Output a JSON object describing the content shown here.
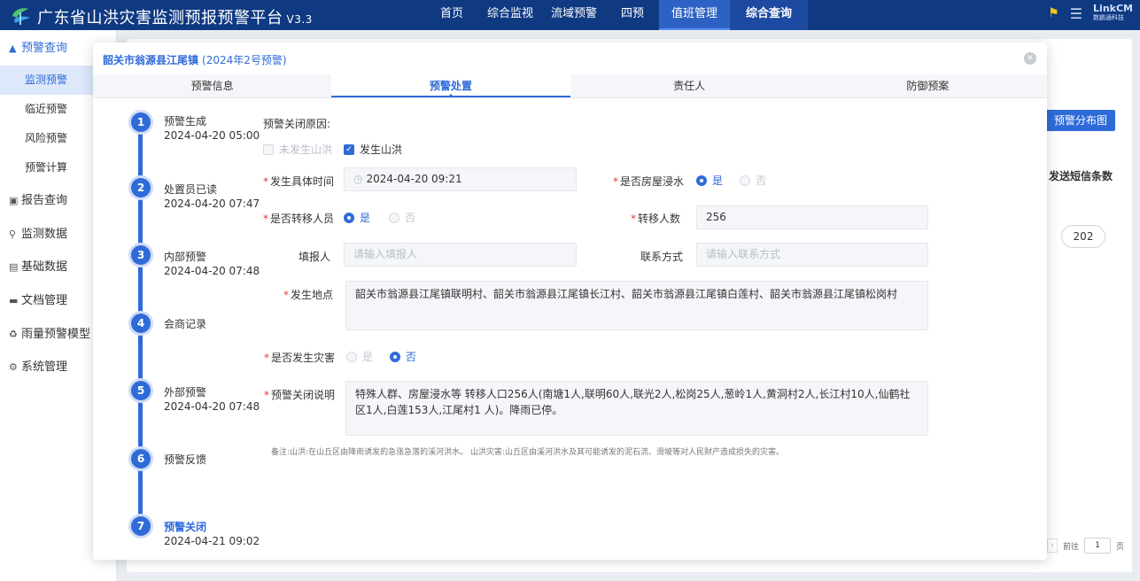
{
  "header": {
    "app_title": "广东省山洪灾害监测预报预警平台",
    "version": "V3.3",
    "nav": [
      "首页",
      "综合监视",
      "流域预警",
      "四预",
      "值班管理",
      "综合查询"
    ],
    "brand": "LinkCM",
    "brand_sub": "数鹏通科技"
  },
  "sidebar": {
    "groups": [
      "预警查询",
      "报告查询",
      "监测数据",
      "基础数据",
      "文档管理",
      "雨量预警模型",
      "系统管理"
    ],
    "sub_items": [
      "监测预警",
      "临近预警",
      "风险预警",
      "预警计算"
    ]
  },
  "background": {
    "dist_button": "预警分布图",
    "sms_header": "发送短信条数",
    "sms_count": "202",
    "pager_goto": "前往",
    "pager_page": "1",
    "pager_unit": "页"
  },
  "modal": {
    "title": "韶关市翁源县江尾镇",
    "subtitle": "(2024年2号预警)",
    "close_icon": "×",
    "tabs": [
      "预警信息",
      "预警处置",
      "责任人",
      "防御预案"
    ],
    "timeline": [
      {
        "num": "1",
        "name": "预警生成",
        "time": "2024-04-20 05:00"
      },
      {
        "num": "2",
        "name": "处置员已读",
        "time": "2024-04-20 07:47"
      },
      {
        "num": "3",
        "name": "内部预警",
        "time": "2024-04-20 07:48"
      },
      {
        "num": "4",
        "name": "会商记录",
        "time": ""
      },
      {
        "num": "5",
        "name": "外部预警",
        "time": "2024-04-20 07:48"
      },
      {
        "num": "6",
        "name": "预警反馈",
        "time": ""
      },
      {
        "num": "7",
        "name": "预警关闭",
        "time": "2024-04-21 09:02"
      }
    ],
    "form": {
      "close_reason_label": "预警关闭原因:",
      "opt_no_flood": "未发生山洪",
      "opt_flood": "发生山洪",
      "time_label": "发生具体时间",
      "time_value": "2024-04-20 09:21",
      "house_label": "是否房屋浸水",
      "yes": "是",
      "no": "否",
      "transfer_label": "是否转移人员",
      "transfer_count_label": "转移人数",
      "transfer_count": "256",
      "reporter_label": "填报人",
      "reporter_placeholder": "请输入填报人",
      "contact_label": "联系方式",
      "contact_placeholder": "请输入联系方式",
      "location_label": "发生地点",
      "location_value": "韶关市翁源县江尾镇联明村、韶关市翁源县江尾镇长江村、韶关市翁源县江尾镇白莲村、韶关市翁源县江尾镇松岗村",
      "disaster_label": "是否发生灾害",
      "desc_label": "预警关闭说明",
      "desc_value": "特殊人群、房屋浸水等 转移人口256人(南塘1人,联明60人,联光2人,松岗25人,葱岭1人,黄洞村2人,长江村10人,仙鹤社区1人,白莲153人,江尾村1 人)。降雨已停。",
      "note": "备注:山洪:在山丘区由降雨诱发的急涨急落的溪河洪水。 山洪灾害:山丘区由溪河洪水及其可能诱发的泥石流、滑坡等对人民财产造成损失的灾害。"
    }
  }
}
